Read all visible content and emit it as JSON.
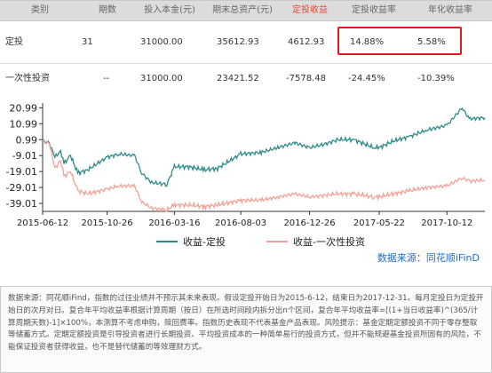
{
  "table": {
    "headers": [
      "类别",
      "期数",
      "投入本金(元)",
      "期末总资产(元)",
      "定投收益",
      "定投收益率",
      "年化收益率"
    ],
    "rows": [
      [
        "定投",
        "31",
        "31000.00",
        "35612.93",
        "4612.93",
        "14.88%",
        "5.58%"
      ],
      [
        "一次性投资",
        "--",
        "31000.00",
        "23421.52",
        "-7578.48",
        "-24.45%",
        "-10.39%"
      ]
    ]
  },
  "chart_data": {
    "type": "line",
    "y_ticks": [
      "20.99",
      "10.99",
      "0.99",
      "-9.01",
      "-19.01",
      "-29.01",
      "-39.01"
    ],
    "x_ticks": [
      "2015-06-12",
      "2015-10-26",
      "2016-03-16",
      "2016-08-03",
      "2016-12-26",
      "2017-05-22",
      "2017-10-12"
    ],
    "ylim": [
      -44,
      24
    ],
    "x_range": [
      "2015-06-12",
      "2017-12-31"
    ],
    "grid": false,
    "legend_position": "bottom",
    "series": [
      {
        "name": "收益-定投",
        "color": "#2e8b8b",
        "points": [
          [
            "2015-06-12",
            0
          ],
          [
            "2015-06-26",
            -1
          ],
          [
            "2015-07-08",
            -10
          ],
          [
            "2015-07-20",
            -6
          ],
          [
            "2015-07-27",
            -14
          ],
          [
            "2015-08-10",
            -9
          ],
          [
            "2015-08-25",
            -20
          ],
          [
            "2015-09-15",
            -18
          ],
          [
            "2015-10-26",
            -10
          ],
          [
            "2015-11-20",
            -8
          ],
          [
            "2015-12-23",
            -9
          ],
          [
            "2016-01-07",
            -20
          ],
          [
            "2016-01-28",
            -26
          ],
          [
            "2016-02-29",
            -27
          ],
          [
            "2016-03-16",
            -16
          ],
          [
            "2016-04-15",
            -16
          ],
          [
            "2016-05-18",
            -18
          ],
          [
            "2016-06-15",
            -17
          ],
          [
            "2016-08-03",
            -8
          ],
          [
            "2016-09-15",
            -7
          ],
          [
            "2016-10-20",
            -4
          ],
          [
            "2016-11-25",
            -1
          ],
          [
            "2016-12-26",
            -4
          ],
          [
            "2017-01-25",
            -2
          ],
          [
            "2017-02-24",
            1
          ],
          [
            "2017-03-30",
            1
          ],
          [
            "2017-05-10",
            -4
          ],
          [
            "2017-05-22",
            -4
          ],
          [
            "2017-06-20",
            0
          ],
          [
            "2017-07-25",
            3
          ],
          [
            "2017-08-30",
            7
          ],
          [
            "2017-10-12",
            10
          ],
          [
            "2017-11-13",
            21
          ],
          [
            "2017-11-28",
            14
          ],
          [
            "2017-12-31",
            14.9
          ]
        ]
      },
      {
        "name": "收益-一次性投资",
        "color": "#f5a196",
        "points": [
          [
            "2015-06-12",
            0
          ],
          [
            "2015-06-26",
            -1
          ],
          [
            "2015-07-08",
            -17
          ],
          [
            "2015-07-20",
            -12
          ],
          [
            "2015-07-27",
            -22
          ],
          [
            "2015-08-10",
            -19
          ],
          [
            "2015-08-25",
            -31
          ],
          [
            "2015-09-15",
            -33
          ],
          [
            "2015-10-26",
            -30
          ],
          [
            "2015-11-20",
            -28
          ],
          [
            "2015-12-23",
            -28
          ],
          [
            "2016-01-07",
            -38
          ],
          [
            "2016-01-28",
            -42
          ],
          [
            "2016-02-29",
            -43
          ],
          [
            "2016-03-16",
            -40
          ],
          [
            "2016-04-15",
            -40
          ],
          [
            "2016-05-18",
            -41
          ],
          [
            "2016-06-15",
            -40
          ],
          [
            "2016-08-03",
            -37
          ],
          [
            "2016-09-15",
            -37
          ],
          [
            "2016-10-20",
            -35
          ],
          [
            "2016-11-25",
            -33
          ],
          [
            "2016-12-26",
            -35
          ],
          [
            "2017-01-25",
            -34
          ],
          [
            "2017-02-24",
            -33
          ],
          [
            "2017-03-30",
            -33
          ],
          [
            "2017-05-10",
            -35
          ],
          [
            "2017-05-22",
            -35
          ],
          [
            "2017-06-20",
            -33
          ],
          [
            "2017-07-25",
            -31
          ],
          [
            "2017-08-30",
            -29
          ],
          [
            "2017-10-12",
            -28
          ],
          [
            "2017-11-13",
            -23
          ],
          [
            "2017-11-28",
            -25
          ],
          [
            "2017-12-31",
            -24.45
          ]
        ]
      }
    ],
    "source_label": "数据来源：同花顺iFinD",
    "source_color": "#1a6fd6"
  },
  "note": "数据来源：同花顺iFind，指数的过往业绩并不预示其未来表现。假设定投开始日为2015-6-12，结束日为2017-12-31。每月定投日为定投开始日的次月对日。复合年平均收益率根据计算周期（按日）在所选时间段内拆分出n个区间，复合年平均收益率=[(1+当日收益率)^(365/计算周期天数)-1]×100%，本测算不考虑申购，赎回费率。指数历史表现不代表基金产品表现。风险提示：基金定期定额投资不同于零存整取等储蓄方式。定期定额投资是引导投资者进行长期投资、平均投资成本的一种简单易行的投资方式，但并不能规避基金投资所固有的风险，不能保证投资者获得收益，也不是替代储蓄的等效理财方式。",
  "colors": {
    "header_bg": "#dcdcdc",
    "highlight": "#e5161d",
    "axis": "#333333"
  }
}
